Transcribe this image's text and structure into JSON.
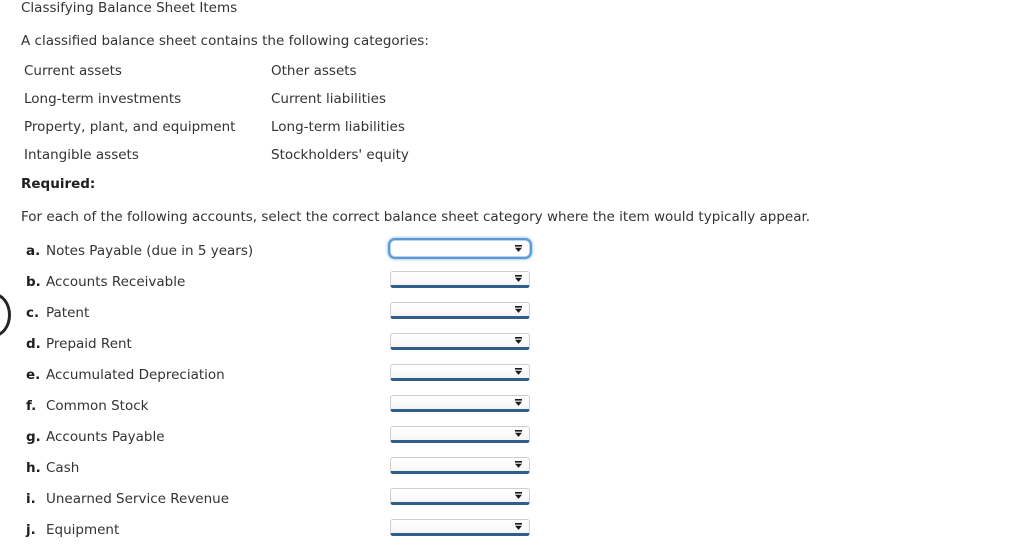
{
  "document": {
    "title": "Classifying Balance Sheet Items",
    "intro": "A classified balance sheet contains the following categories:",
    "required_label": "Required:",
    "instruction": "For each of the following accounts, select the correct balance sheet category where the item would typically appear."
  },
  "categories": [
    {
      "left": "Current assets",
      "right": "Other assets"
    },
    {
      "left": "Long-term investments",
      "right": "Current liabilities"
    },
    {
      "left": "Property, plant, and equipment",
      "right": "Long-term liabilities"
    },
    {
      "left": "Intangible assets",
      "right": "Stockholders' equity"
    }
  ],
  "accounts": [
    {
      "letter": "a.",
      "name": "Notes Payable (due in 5 years)",
      "value": "",
      "focused": true
    },
    {
      "letter": "b.",
      "name": "Accounts Receivable",
      "value": "",
      "focused": false
    },
    {
      "letter": "c.",
      "name": "Patent",
      "value": "",
      "focused": false
    },
    {
      "letter": "d.",
      "name": "Prepaid Rent",
      "value": "",
      "focused": false
    },
    {
      "letter": "e.",
      "name": "Accumulated Depreciation",
      "value": "",
      "focused": false
    },
    {
      "letter": "f.",
      "name": "Common Stock",
      "value": "",
      "focused": false
    },
    {
      "letter": "g.",
      "name": "Accounts Payable",
      "value": "",
      "focused": false
    },
    {
      "letter": "h.",
      "name": "Cash",
      "value": "",
      "focused": false
    },
    {
      "letter": "i.",
      "name": "Unearned Service Revenue",
      "value": "",
      "focused": false
    },
    {
      "letter": "j.",
      "name": "Equipment",
      "value": "",
      "focused": false
    }
  ],
  "select": {
    "icon": "chevron-down-icon",
    "placeholder": ""
  },
  "colors": {
    "text": "#333333",
    "heading": "#1f1f1f",
    "select_underline": "#2e5f8a",
    "focus_ring": "#5b9bd5",
    "background": "#ffffff"
  }
}
